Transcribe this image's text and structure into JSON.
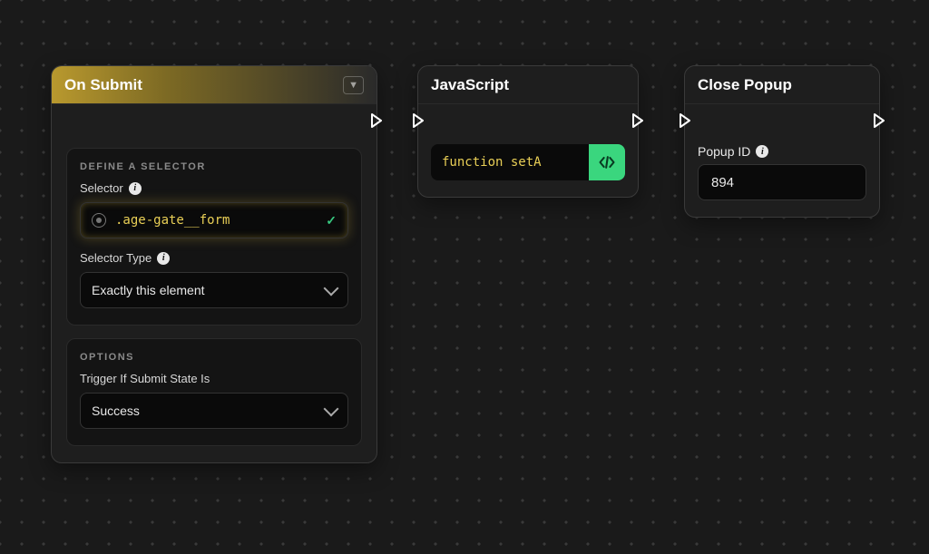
{
  "nodes": {
    "on_submit": {
      "title": "On Submit",
      "selector_section": "DEFINE A SELECTOR",
      "selector_label": "Selector",
      "selector_value": ".age-gate__form",
      "selector_type_label": "Selector Type",
      "selector_type_value": "Exactly this element",
      "options_section": "OPTIONS",
      "trigger_label": "Trigger If Submit State Is",
      "trigger_value": "Success"
    },
    "javascript": {
      "title": "JavaScript",
      "code_preview": "function setA"
    },
    "close_popup": {
      "title": "Close Popup",
      "popup_id_label": "Popup ID",
      "popup_id_value": "894"
    }
  }
}
